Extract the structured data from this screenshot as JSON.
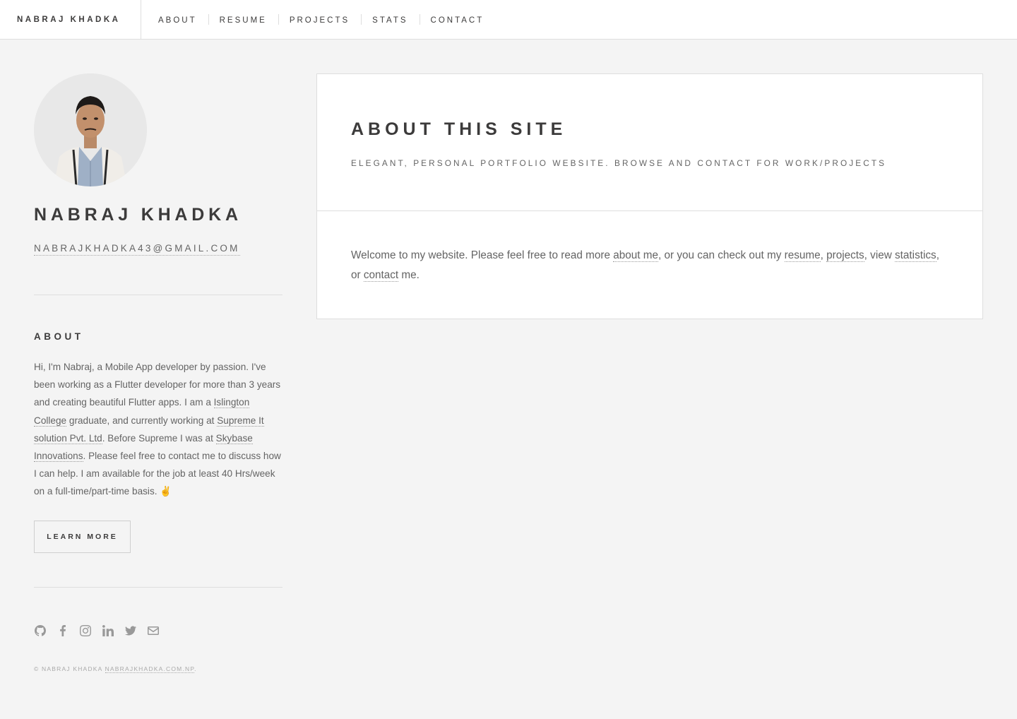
{
  "header": {
    "brand": "Nabraj Khadka",
    "nav": [
      "About",
      "Resume",
      "Projects",
      "Stats",
      "Contact"
    ]
  },
  "sidebar": {
    "name": "Nabraj Khadka",
    "email": "nabrajkhadka43@gmail.com",
    "about_heading": "About",
    "about_text_1": "Hi, I'm Nabraj, a Mobile App developer by passion. I've been working as a Flutter developer for more than 3 years and creating beautiful Flutter apps. I am a ",
    "link_college": "Islington College",
    "about_text_2": " graduate, and currently working at ",
    "link_supreme": "Supreme It solution Pvt. Ltd",
    "about_text_3": ". Before Supreme I was at ",
    "link_skybase": "Skybase Innovations",
    "about_text_4": ". Please feel free to contact me to discuss how I can help. I am available for the job at least 40 Hrs/week on a full-time/part-time basis. ✌",
    "learn_more": "Learn More",
    "social_icons": [
      "github-icon",
      "facebook-icon",
      "instagram-icon",
      "linkedin-icon",
      "twitter-icon",
      "mail-icon"
    ],
    "copyright_text": "© Nabraj Khadka ",
    "copyright_link": "nabrajkhadka.com.np",
    "copyright_end": "."
  },
  "main": {
    "title": "About this site",
    "subtitle": "Elegant, personal portfolio website. Browse and contact for work/projects",
    "body_1": "Welcome to my website. Please feel free to read more ",
    "link_about": "about me",
    "body_2": ", or you can check out my ",
    "link_resume": "resume",
    "body_3": ", ",
    "link_projects": "projects",
    "body_4": ", view ",
    "link_statistics": "statistics",
    "body_5": ", or ",
    "link_contact": "contact",
    "body_6": " me."
  },
  "colors": {
    "background": "#f4f4f4",
    "heading": "#3c3b3b",
    "text": "#646464",
    "border": "#dedede"
  }
}
